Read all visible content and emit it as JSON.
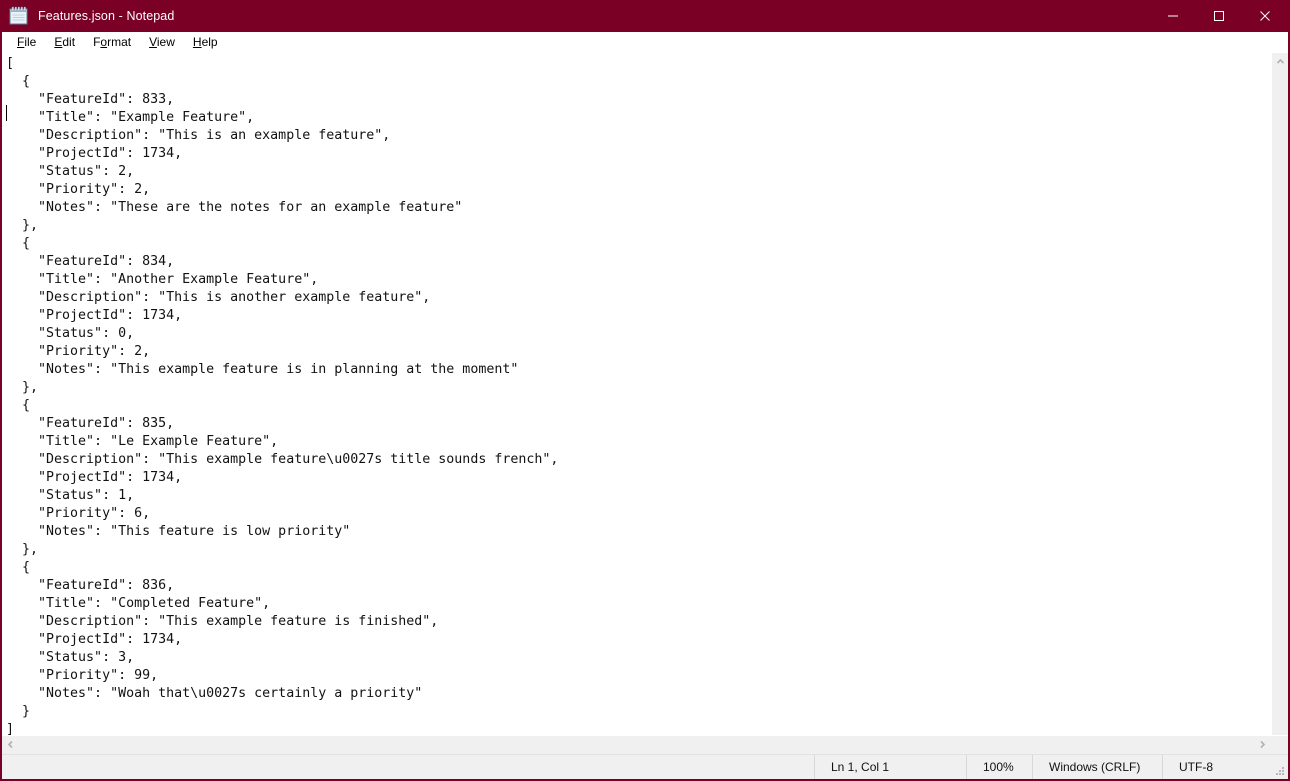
{
  "window": {
    "title": "Features.json - Notepad",
    "icon": "notepad-icon",
    "titlebar_color": "#7a0026",
    "controls": {
      "minimize": "minimize-icon",
      "maximize": "maximize-icon",
      "close": "close-icon"
    }
  },
  "menu": {
    "items": [
      {
        "label": "File",
        "accel": "F"
      },
      {
        "label": "Edit",
        "accel": "E"
      },
      {
        "label": "Format",
        "accel": "o"
      },
      {
        "label": "View",
        "accel": "V"
      },
      {
        "label": "Help",
        "accel": "H"
      }
    ]
  },
  "editor": {
    "content": "[\n  {\n    \"FeatureId\": 833,\n    \"Title\": \"Example Feature\",\n    \"Description\": \"This is an example feature\",\n    \"ProjectId\": 1734,\n    \"Status\": 2,\n    \"Priority\": 2,\n    \"Notes\": \"These are the notes for an example feature\"\n  },\n  {\n    \"FeatureId\": 834,\n    \"Title\": \"Another Example Feature\",\n    \"Description\": \"This is another example feature\",\n    \"ProjectId\": 1734,\n    \"Status\": 0,\n    \"Priority\": 2,\n    \"Notes\": \"This example feature is in planning at the moment\"\n  },\n  {\n    \"FeatureId\": 835,\n    \"Title\": \"Le Example Feature\",\n    \"Description\": \"This example feature\\u0027s title sounds french\",\n    \"ProjectId\": 1734,\n    \"Status\": 1,\n    \"Priority\": 6,\n    \"Notes\": \"This feature is low priority\"\n  },\n  {\n    \"FeatureId\": 836,\n    \"Title\": \"Completed Feature\",\n    \"Description\": \"This example feature is finished\",\n    \"ProjectId\": 1734,\n    \"Status\": 3,\n    \"Priority\": 99,\n    \"Notes\": \"Woah that\\u0027s certainly a priority\"\n  }\n]"
  },
  "scrollbars": {
    "vertical_up": "chevron-up-icon",
    "horizontal_left": "chevron-left-icon",
    "horizontal_right": "chevron-right-icon"
  },
  "statusbar": {
    "position": "Ln 1, Col 1",
    "zoom": "100%",
    "line_ending": "Windows (CRLF)",
    "encoding": "UTF-8"
  }
}
